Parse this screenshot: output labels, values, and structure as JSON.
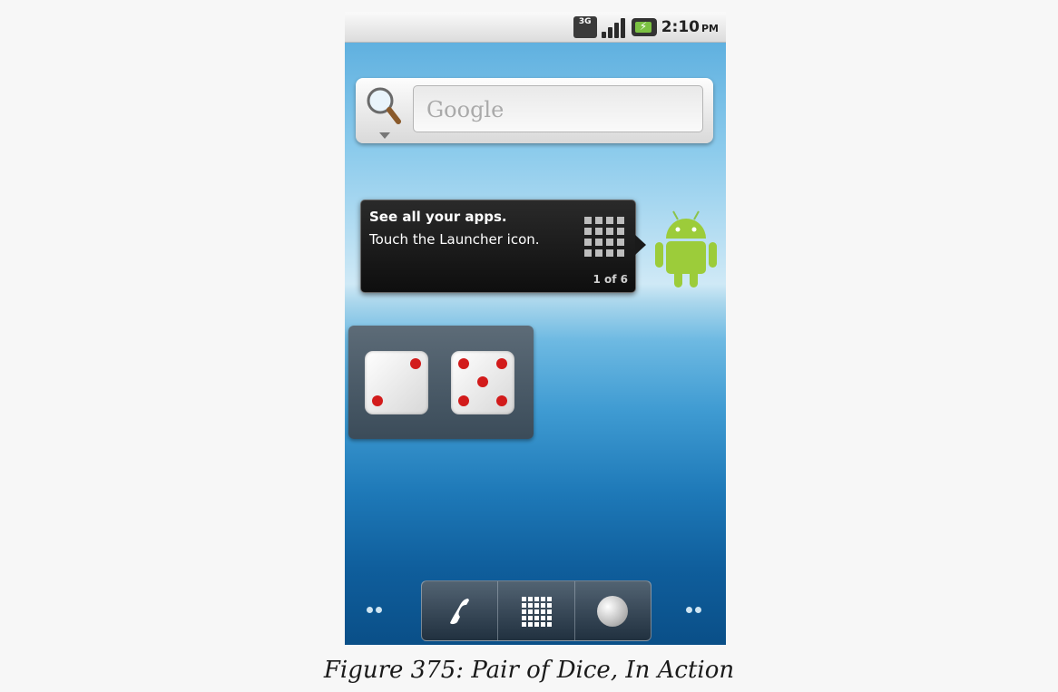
{
  "status_bar": {
    "network": "3G",
    "time": "2:10",
    "meridiem": "PM"
  },
  "search": {
    "placeholder": "Google"
  },
  "tooltip": {
    "title": "See all your apps.",
    "body": "Touch the Launcher icon.",
    "counter": "1 of 6"
  },
  "dice": {
    "die1": 2,
    "die2": 5,
    "pip_color": "#d21b1b"
  },
  "dock": {
    "items": [
      "phone-icon",
      "launcher-grid-icon",
      "browser-globe-icon"
    ]
  },
  "caption": "Figure 375: Pair of Dice, In Action"
}
